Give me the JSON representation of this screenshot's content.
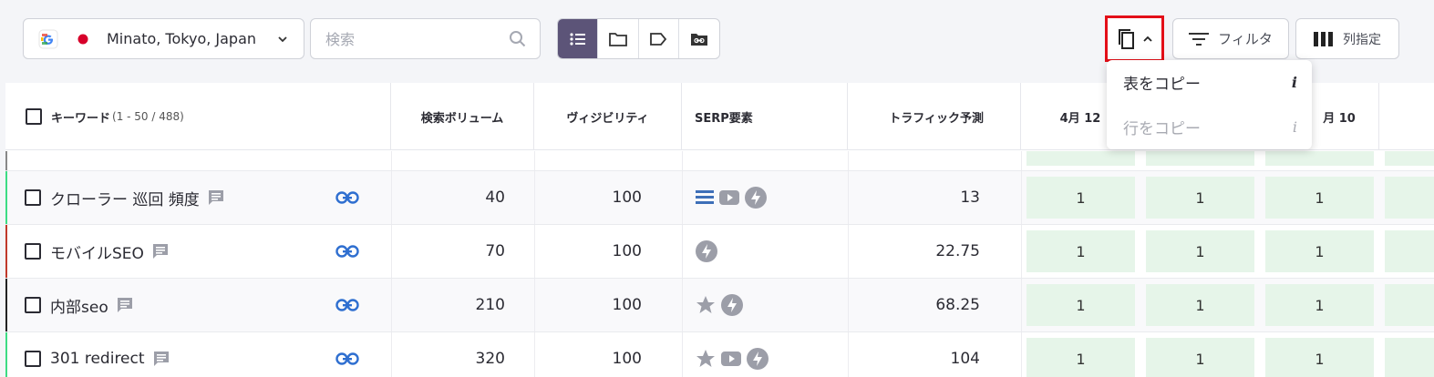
{
  "toolbar": {
    "location": "Minato, Tokyo, Japan",
    "search_placeholder": "検索",
    "filter_label": "フィルタ",
    "columns_label": "列指定"
  },
  "copy_menu": {
    "items": [
      {
        "label": "表をコピー",
        "info": "i",
        "disabled": false
      },
      {
        "label": "行をコピー",
        "info": "i",
        "disabled": true
      }
    ]
  },
  "table": {
    "headers": {
      "keyword": "キーワード",
      "keyword_count": "(1 - 50 / 488)",
      "volume": "検索ボリューム",
      "visibility": "ヴィジビリティ",
      "serp": "SERP要素",
      "traffic": "トラフィック予測",
      "date1": "4月 12",
      "date3": "月 10"
    },
    "rows": [
      {
        "keyword": "クローラー 巡回 頻度",
        "volume": "40",
        "visibility": "100",
        "serp": [
          "list-icon",
          "video-icon",
          "amp-icon"
        ],
        "traffic": "13",
        "ranks": [
          "1",
          "1",
          "1"
        ],
        "accent": "#3ddc84"
      },
      {
        "keyword": "モバイルSEO",
        "volume": "70",
        "visibility": "100",
        "serp": [
          "amp-icon"
        ],
        "traffic": "22.75",
        "ranks": [
          "1",
          "1",
          "1"
        ],
        "accent": "#c0392b"
      },
      {
        "keyword": "内部seo",
        "volume": "210",
        "visibility": "100",
        "serp": [
          "star-icon",
          "amp-icon"
        ],
        "traffic": "68.25",
        "ranks": [
          "1",
          "1",
          "1"
        ],
        "accent": "#222222"
      },
      {
        "keyword": "301 redirect",
        "volume": "320",
        "visibility": "100",
        "serp": [
          "star-icon",
          "video-icon",
          "amp-icon"
        ],
        "traffic": "104",
        "ranks": [
          "1",
          "1",
          "1"
        ],
        "accent": "#3ddc84"
      }
    ]
  },
  "colors": {
    "active_view": "#5c5478",
    "highlight_border": "#e30f18",
    "rank_cell_bg": "#e6f5e9",
    "link_icon": "#2f6fd0"
  }
}
